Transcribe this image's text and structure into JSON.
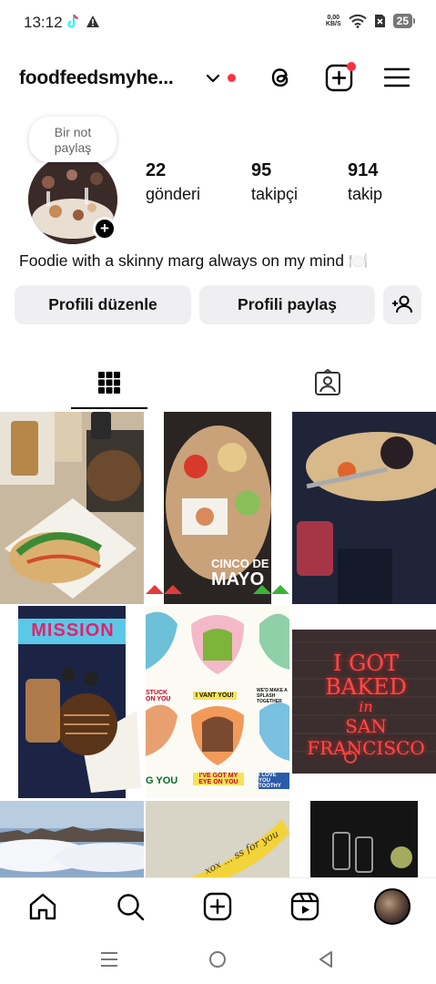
{
  "status_bar": {
    "time": "13:12",
    "speed_value": "0,00",
    "speed_unit": "KB/S",
    "battery": "25"
  },
  "header": {
    "username": "foodfeedsmyhe...",
    "icons": [
      "chevron-down-icon",
      "threads-icon",
      "create-post-icon",
      "menu-icon"
    ]
  },
  "profile": {
    "note_line1": "Bir not",
    "note_line2": "paylaş",
    "stats": [
      {
        "value": "22",
        "label": "gönderi"
      },
      {
        "value": "95",
        "label": "takipçi"
      },
      {
        "value": "914",
        "label": "takip"
      }
    ],
    "bio": "Foodie with a skinny marg always on my mind 🍽️"
  },
  "buttons": {
    "edit_profile": "Profili düzenle",
    "share_profile": "Profili paylaş"
  },
  "grid": {
    "tiles": [
      {
        "name": "post-sandwich-drinks"
      },
      {
        "name": "post-cinco-de-mayo",
        "text_line1": "CINCO DE",
        "text_line2": "MAYO"
      },
      {
        "name": "post-cheese-plate"
      },
      {
        "name": "post-mission-pastry",
        "text": "MISSION"
      },
      {
        "name": "post-monster-valentines",
        "text": [
          "STUCK ON YOU",
          "I VANT YOU!",
          "WE'D MAKE A SPLASH TOGETHER",
          "G YOU",
          "I'VE GOT MY EYE ON YOU",
          "I LOVE YOU TOOTHY"
        ]
      },
      {
        "name": "post-neon-sign",
        "text_line1": "I GOT BAKED",
        "text_line2": "in",
        "text_line3": "SAN FRANCISCO"
      },
      {
        "name": "post-fog-city"
      },
      {
        "name": "post-banana",
        "text": "xox ... ss for you"
      },
      {
        "name": "post-glasses"
      }
    ]
  },
  "colors": {
    "notification_dot": "#ff3040",
    "button_bg": "#efeff2",
    "neon_red": "#ff3b3b"
  }
}
